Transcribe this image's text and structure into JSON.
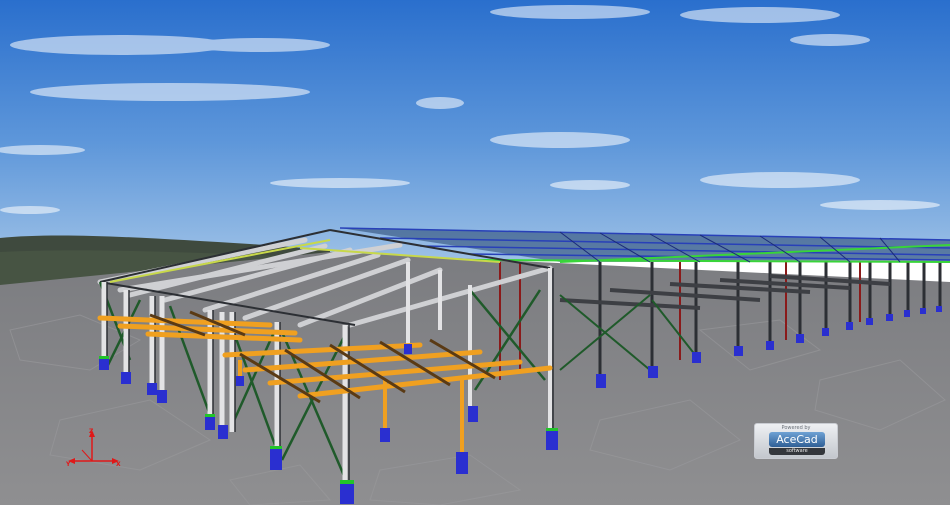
{
  "viewer": {
    "axes": {
      "z_label": "Z",
      "x_label": "X",
      "y_label": "Y"
    },
    "logo": {
      "powered_by": "Powered by",
      "brand": "AceCad",
      "subtitle": "software"
    }
  },
  "colors": {
    "sky_top": "#2c72cf",
    "sky_bottom": "#8eb6e2",
    "ground": "#8a8a8c",
    "beam_white": "#d8d8d8",
    "beam_orange": "#f0a020",
    "brace_green": "#1f5a2a",
    "roof_green": "#39d43a",
    "roof_blue": "#2840b8",
    "column_dark": "#2c2f34",
    "column_red": "#8a1a1a",
    "base_blue": "#2a2fd0"
  }
}
